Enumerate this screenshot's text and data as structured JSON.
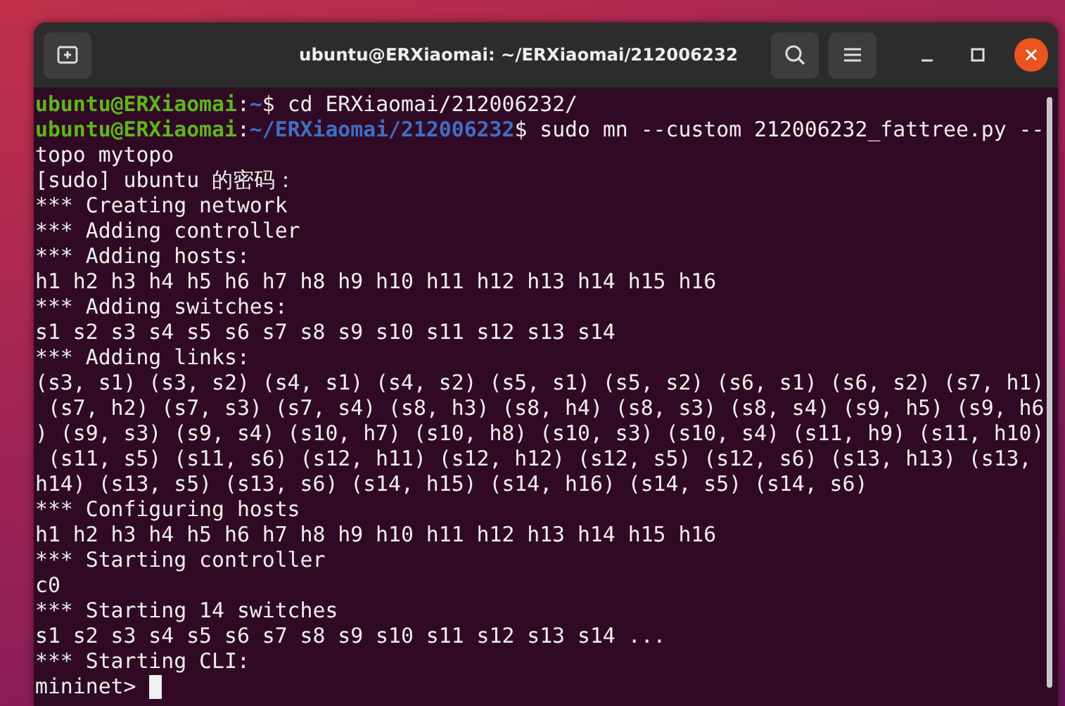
{
  "window": {
    "title": "ubuntu@ERXiaomai: ~/ERXiaomai/212006232"
  },
  "terminal": {
    "lines": [
      {
        "segments": [
          {
            "kind": "user",
            "text": "ubuntu@ERXiaomai"
          },
          {
            "kind": "plain",
            "text": ":"
          },
          {
            "kind": "path",
            "text": "~"
          },
          {
            "kind": "plain",
            "text": "$ cd ERXiaomai/212006232/"
          }
        ]
      },
      {
        "segments": [
          {
            "kind": "user",
            "text": "ubuntu@ERXiaomai"
          },
          {
            "kind": "plain",
            "text": ":"
          },
          {
            "kind": "path",
            "text": "~/ERXiaomai/212006232"
          },
          {
            "kind": "plain",
            "text": "$ sudo mn --custom 212006232_fattree.py --"
          }
        ]
      },
      {
        "text": "topo mytopo"
      },
      {
        "text": "[sudo] ubuntu 的密码："
      },
      {
        "text": "*** Creating network"
      },
      {
        "text": "*** Adding controller"
      },
      {
        "text": "*** Adding hosts:"
      },
      {
        "text": "h1 h2 h3 h4 h5 h6 h7 h8 h9 h10 h11 h12 h13 h14 h15 h16"
      },
      {
        "text": "*** Adding switches:"
      },
      {
        "text": "s1 s2 s3 s4 s5 s6 s7 s8 s9 s10 s11 s12 s13 s14"
      },
      {
        "text": "*** Adding links:"
      },
      {
        "text": "(s3, s1) (s3, s2) (s4, s1) (s4, s2) (s5, s1) (s5, s2) (s6, s1) (s6, s2) (s7, h1)"
      },
      {
        "text": " (s7, h2) (s7, s3) (s7, s4) (s8, h3) (s8, h4) (s8, s3) (s8, s4) (s9, h5) (s9, h6"
      },
      {
        "text": ") (s9, s3) (s9, s4) (s10, h7) (s10, h8) (s10, s3) (s10, s4) (s11, h9) (s11, h10)"
      },
      {
        "text": " (s11, s5) (s11, s6) (s12, h11) (s12, h12) (s12, s5) (s12, s6) (s13, h13) (s13,"
      },
      {
        "text": "h14) (s13, s5) (s13, s6) (s14, h15) (s14, h16) (s14, s5) (s14, s6)"
      },
      {
        "text": "*** Configuring hosts"
      },
      {
        "text": "h1 h2 h3 h4 h5 h6 h7 h8 h9 h10 h11 h12 h13 h14 h15 h16"
      },
      {
        "text": "*** Starting controller"
      },
      {
        "text": "c0"
      },
      {
        "text": "*** Starting 14 switches"
      },
      {
        "text": "s1 s2 s3 s4 s5 s6 s7 s8 s9 s10 s11 s12 s13 s14 ..."
      },
      {
        "text": "*** Starting CLI:"
      },
      {
        "text": "mininet> ",
        "cursor": true
      }
    ]
  }
}
